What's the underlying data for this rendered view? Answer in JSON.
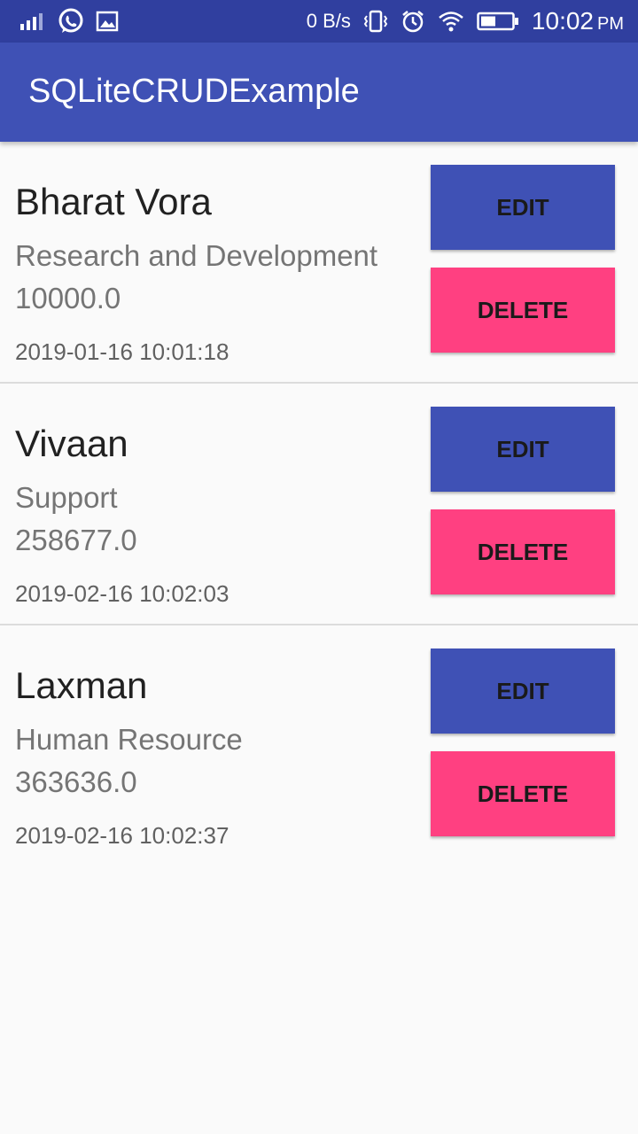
{
  "status_bar": {
    "network_speed": "0 B/s",
    "time": "10:02",
    "ampm": "PM",
    "icons": [
      "signal-icon",
      "whatsapp-icon",
      "gallery-icon",
      "vibrate-icon",
      "alarm-icon",
      "wifi-icon",
      "battery-icon"
    ]
  },
  "app_bar": {
    "title": "SQLiteCRUDExample",
    "color": "#3f51b5"
  },
  "colors": {
    "primary_dark": "#303f9f",
    "primary": "#3f51b5",
    "accent": "#ff4081"
  },
  "employees": [
    {
      "name": "Bharat Vora",
      "department": "Research and Development",
      "salary": "10000.0",
      "joined": "2019-01-16 10:01:18",
      "edit_label": "EDIT",
      "delete_label": "DELETE"
    },
    {
      "name": "Vivaan",
      "department": "Support",
      "salary": "258677.0",
      "joined": "2019-02-16 10:02:03",
      "edit_label": "EDIT",
      "delete_label": "DELETE"
    },
    {
      "name": "Laxman",
      "department": "Human Resource",
      "salary": "363636.0",
      "joined": "2019-02-16 10:02:37",
      "edit_label": "EDIT",
      "delete_label": "DELETE"
    }
  ]
}
